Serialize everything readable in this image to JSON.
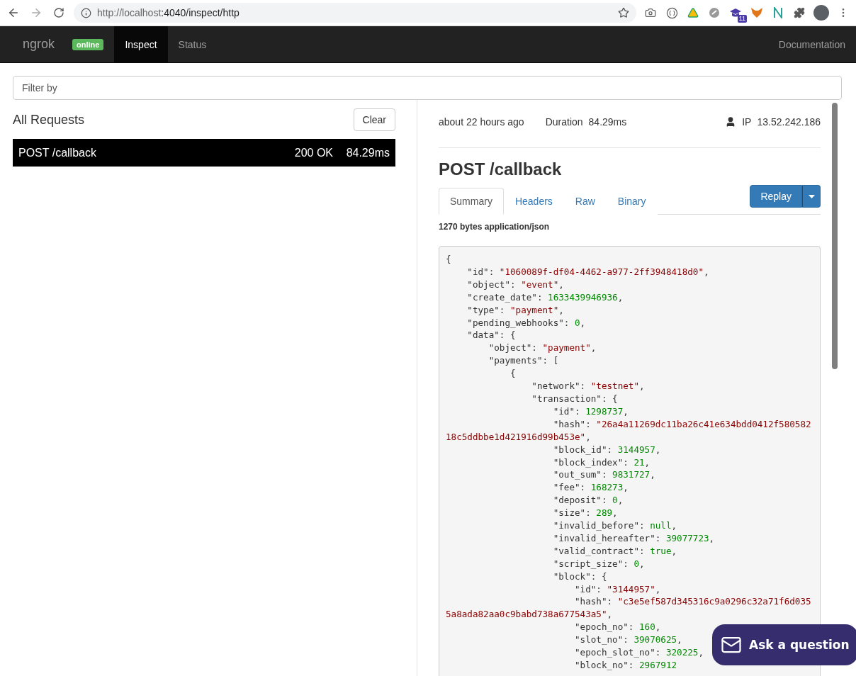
{
  "browser": {
    "url_host": "http://localhost",
    "url_rest": ":4040/inspect/http",
    "extension_badge": "11"
  },
  "navbar": {
    "brand": "ngrok",
    "status_badge": "online",
    "items": [
      {
        "label": "Inspect",
        "selected": true
      },
      {
        "label": "Status",
        "selected": false
      }
    ],
    "right_link": "Documentation"
  },
  "filter": {
    "placeholder": "Filter by"
  },
  "requests_panel": {
    "title": "All Requests",
    "clear_button": "Clear",
    "requests": [
      {
        "method_path": "POST /callback",
        "status": "200 OK",
        "duration": "84.29ms",
        "selected": true
      }
    ]
  },
  "detail": {
    "time": "about 22 hours ago",
    "duration_label": "Duration",
    "duration": "84.29ms",
    "ip_label": "IP",
    "ip": "13.52.242.186",
    "title": "POST /callback",
    "tabs": [
      {
        "label": "Summary",
        "selected": true
      },
      {
        "label": "Headers",
        "selected": false
      },
      {
        "label": "Raw",
        "selected": false
      },
      {
        "label": "Binary",
        "selected": false
      }
    ],
    "replay_button": "Replay",
    "body_info": "1270 bytes application/json",
    "body_lines": [
      [
        {
          "kind": "plain",
          "text": "{"
        }
      ],
      [
        {
          "kind": "plain",
          "text": "    \"id\": "
        },
        {
          "kind": "string",
          "text": "\"1060089f-df04-4462-a977-2ff3948418d0\""
        },
        {
          "kind": "plain",
          "text": ","
        }
      ],
      [
        {
          "kind": "plain",
          "text": "    \"object\": "
        },
        {
          "kind": "string",
          "text": "\"event\""
        },
        {
          "kind": "plain",
          "text": ","
        }
      ],
      [
        {
          "kind": "plain",
          "text": "    \"create_date\": "
        },
        {
          "kind": "number",
          "text": "1633439946936"
        },
        {
          "kind": "plain",
          "text": ","
        }
      ],
      [
        {
          "kind": "plain",
          "text": "    \"type\": "
        },
        {
          "kind": "string",
          "text": "\"payment\""
        },
        {
          "kind": "plain",
          "text": ","
        }
      ],
      [
        {
          "kind": "plain",
          "text": "    \"pending_webhooks\": "
        },
        {
          "kind": "number",
          "text": "0"
        },
        {
          "kind": "plain",
          "text": ","
        }
      ],
      [
        {
          "kind": "plain",
          "text": "    \"data\": {"
        }
      ],
      [
        {
          "kind": "plain",
          "text": "        \"object\": "
        },
        {
          "kind": "string",
          "text": "\"payment\""
        },
        {
          "kind": "plain",
          "text": ","
        }
      ],
      [
        {
          "kind": "plain",
          "text": "        \"payments\": ["
        }
      ],
      [
        {
          "kind": "plain",
          "text": "            {"
        }
      ],
      [
        {
          "kind": "plain",
          "text": "                \"network\": "
        },
        {
          "kind": "string",
          "text": "\"testnet\""
        },
        {
          "kind": "plain",
          "text": ","
        }
      ],
      [
        {
          "kind": "plain",
          "text": "                \"transaction\": {"
        }
      ],
      [
        {
          "kind": "plain",
          "text": "                    \"id\": "
        },
        {
          "kind": "number",
          "text": "1298737"
        },
        {
          "kind": "plain",
          "text": ","
        }
      ],
      [
        {
          "kind": "plain",
          "text": "                    \"hash\": "
        },
        {
          "kind": "string",
          "text": "\"26a4a11269dc11ba26c41e634bdd0412f58058218c5ddbbe1d421916d99b453e\""
        },
        {
          "kind": "plain",
          "text": ","
        }
      ],
      [
        {
          "kind": "plain",
          "text": "                    \"block_id\": "
        },
        {
          "kind": "number",
          "text": "3144957"
        },
        {
          "kind": "plain",
          "text": ","
        }
      ],
      [
        {
          "kind": "plain",
          "text": "                    \"block_index\": "
        },
        {
          "kind": "number",
          "text": "21"
        },
        {
          "kind": "plain",
          "text": ","
        }
      ],
      [
        {
          "kind": "plain",
          "text": "                    \"out_sum\": "
        },
        {
          "kind": "number",
          "text": "9831727"
        },
        {
          "kind": "plain",
          "text": ","
        }
      ],
      [
        {
          "kind": "plain",
          "text": "                    \"fee\": "
        },
        {
          "kind": "number",
          "text": "168273"
        },
        {
          "kind": "plain",
          "text": ","
        }
      ],
      [
        {
          "kind": "plain",
          "text": "                    \"deposit\": "
        },
        {
          "kind": "number",
          "text": "0"
        },
        {
          "kind": "plain",
          "text": ","
        }
      ],
      [
        {
          "kind": "plain",
          "text": "                    \"size\": "
        },
        {
          "kind": "number",
          "text": "289"
        },
        {
          "kind": "plain",
          "text": ","
        }
      ],
      [
        {
          "kind": "plain",
          "text": "                    \"invalid_before\": "
        },
        {
          "kind": "number",
          "text": "null"
        },
        {
          "kind": "plain",
          "text": ","
        }
      ],
      [
        {
          "kind": "plain",
          "text": "                    \"invalid_hereafter\": "
        },
        {
          "kind": "number",
          "text": "39077723"
        },
        {
          "kind": "plain",
          "text": ","
        }
      ],
      [
        {
          "kind": "plain",
          "text": "                    \"valid_contract\": "
        },
        {
          "kind": "number",
          "text": "true"
        },
        {
          "kind": "plain",
          "text": ","
        }
      ],
      [
        {
          "kind": "plain",
          "text": "                    \"script_size\": "
        },
        {
          "kind": "number",
          "text": "0"
        },
        {
          "kind": "plain",
          "text": ","
        }
      ],
      [
        {
          "kind": "plain",
          "text": "                    \"block\": {"
        }
      ],
      [
        {
          "kind": "plain",
          "text": "                        \"id\": "
        },
        {
          "kind": "string",
          "text": "\"3144957\""
        },
        {
          "kind": "plain",
          "text": ","
        }
      ],
      [
        {
          "kind": "plain",
          "text": "                        \"hash\": "
        },
        {
          "kind": "string",
          "text": "\"c3e5ef587d345316c9a0296c32a71f6d0355a8ada82aa0c9babd738a677543a5\""
        },
        {
          "kind": "plain",
          "text": ","
        }
      ],
      [
        {
          "kind": "plain",
          "text": "                        \"epoch_no\": "
        },
        {
          "kind": "number",
          "text": "160"
        },
        {
          "kind": "plain",
          "text": ","
        }
      ],
      [
        {
          "kind": "plain",
          "text": "                        \"slot_no\": "
        },
        {
          "kind": "number",
          "text": "39070625"
        },
        {
          "kind": "plain",
          "text": ","
        }
      ],
      [
        {
          "kind": "plain",
          "text": "                        \"epoch_slot_no\": "
        },
        {
          "kind": "number",
          "text": "320225"
        },
        {
          "kind": "plain",
          "text": ","
        }
      ],
      [
        {
          "kind": "plain",
          "text": "                        \"block_no\": "
        },
        {
          "kind": "number",
          "text": "2967912"
        }
      ]
    ]
  },
  "chat_button": "Ask a question"
}
